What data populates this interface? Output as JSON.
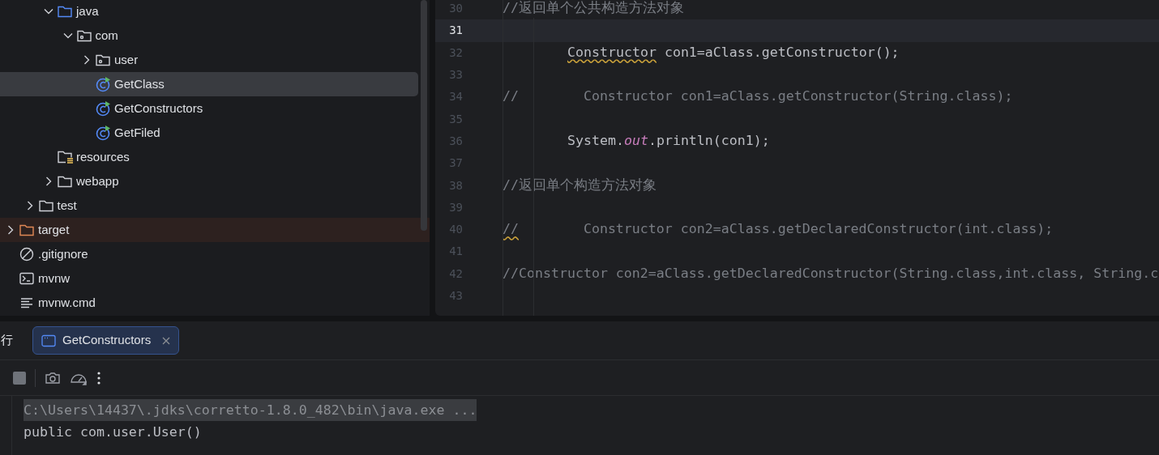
{
  "project_tree": [
    {
      "children": [
        {
          "children": [
            {
              "label": "java",
              "kind": "source-folder",
              "expanded": true,
              "selected": false,
              "children": [
                {
                  "label": "com",
                  "kind": "package",
                  "expanded": true,
                  "selected": false,
                  "children": [
                    {
                      "label": "user",
                      "kind": "package",
                      "expanded": false,
                      "selected": false
                    },
                    {
                      "label": "GetClass",
                      "kind": "class",
                      "selected": true
                    },
                    {
                      "label": "GetConstructors",
                      "kind": "class",
                      "selected": false
                    },
                    {
                      "label": "GetFiled",
                      "kind": "class",
                      "selected": false
                    }
                  ]
                }
              ]
            },
            {
              "label": "resources",
              "kind": "resources-folder",
              "selected": false
            },
            {
              "label": "webapp",
              "kind": "folder",
              "expanded": false,
              "selected": false
            }
          ]
        },
        {
          "label": "test",
          "kind": "folder",
          "expanded": false,
          "selected": false
        }
      ]
    },
    {
      "label": "target",
      "kind": "excluded-folder",
      "expanded": false,
      "selected": false
    },
    {
      "label": ".gitignore",
      "kind": "ignored-file",
      "selected": false
    },
    {
      "label": "mvnw",
      "kind": "terminal-file",
      "selected": false
    },
    {
      "label": "mvnw.cmd",
      "kind": "text-file",
      "selected": false
    }
  ],
  "editor": {
    "lines": [
      {
        "number": "30",
        "current": false,
        "indented": false,
        "segments": [
          {
            "kind": "comment",
            "text": "//返回单个公共构造方法对象"
          }
        ]
      },
      {
        "number": "31",
        "current": true
      },
      {
        "number": "32",
        "current": false,
        "indented": true,
        "segments": [
          {
            "kind": "warning",
            "text": "Constructor"
          },
          {
            "kind": "plain",
            "text": " con1=aClass.getConstructor();"
          }
        ]
      },
      {
        "number": "33",
        "current": false
      },
      {
        "number": "34",
        "current": false,
        "indented": false,
        "segments": [
          {
            "kind": "comment",
            "text": "//        Constructor con1=aClass.getConstructor(String.class);"
          }
        ]
      },
      {
        "number": "35",
        "current": false
      },
      {
        "number": "36",
        "current": false,
        "indented": true,
        "segments": [
          {
            "kind": "plain",
            "text": "System."
          },
          {
            "kind": "static-field",
            "text": "out"
          },
          {
            "kind": "plain",
            "text": ".println(con1);"
          }
        ]
      },
      {
        "number": "37",
        "current": false
      },
      {
        "number": "38",
        "current": false,
        "indented": false,
        "segments": [
          {
            "kind": "comment",
            "text": "//返回单个构造方法对象"
          }
        ]
      },
      {
        "number": "39",
        "current": false
      },
      {
        "number": "40",
        "current": false,
        "indented": false,
        "segments": [
          {
            "kind": "comment-warning",
            "text": "//"
          },
          {
            "kind": "comment",
            "text": "        Constructor con2=aClass.getDeclaredConstructor(int.class);"
          }
        ]
      },
      {
        "number": "41",
        "current": false
      },
      {
        "number": "42",
        "current": false,
        "indented": false,
        "segments": [
          {
            "kind": "comment",
            "text": "//Constructor con2=aClass.getDeclaredConstructor(String.class,int.class, String.c"
          }
        ]
      },
      {
        "number": "43",
        "current": false
      }
    ]
  },
  "run_panel": {
    "title": "行",
    "tabs": [
      {
        "label": "GetConstructors",
        "selected": true
      }
    ],
    "console": [
      {
        "text": "C:\\Users\\14437\\.jdks\\corretto-1.8.0_482\\bin\\java.exe ...",
        "kind": "command"
      },
      {
        "text": "public com.user.User()",
        "kind": "output"
      }
    ]
  }
}
